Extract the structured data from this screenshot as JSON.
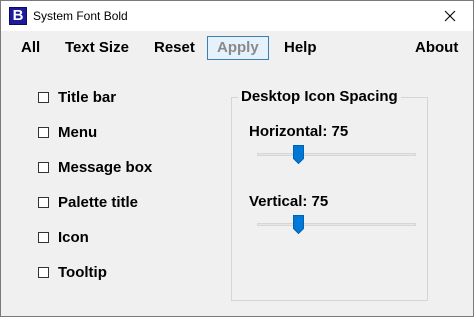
{
  "window": {
    "title": "System Font Bold",
    "app_icon_letter": "B",
    "accent_color": "#0078d7"
  },
  "menu": {
    "all": "All",
    "text_size": "Text Size",
    "reset": "Reset",
    "apply": "Apply",
    "help": "Help",
    "about": "About"
  },
  "checkboxes": [
    {
      "label": "Title bar",
      "checked": false
    },
    {
      "label": "Menu",
      "checked": false
    },
    {
      "label": "Message box",
      "checked": false
    },
    {
      "label": "Palette title",
      "checked": false
    },
    {
      "label": "Icon",
      "checked": false
    },
    {
      "label": "Tooltip",
      "checked": false
    }
  ],
  "icon_spacing": {
    "group_title": "Desktop Icon Spacing",
    "horizontal_label": "Horizontal: 75",
    "horizontal_value": 75,
    "vertical_label": "Vertical: 75",
    "vertical_value": 75,
    "slider_position_fraction": 0.26
  }
}
